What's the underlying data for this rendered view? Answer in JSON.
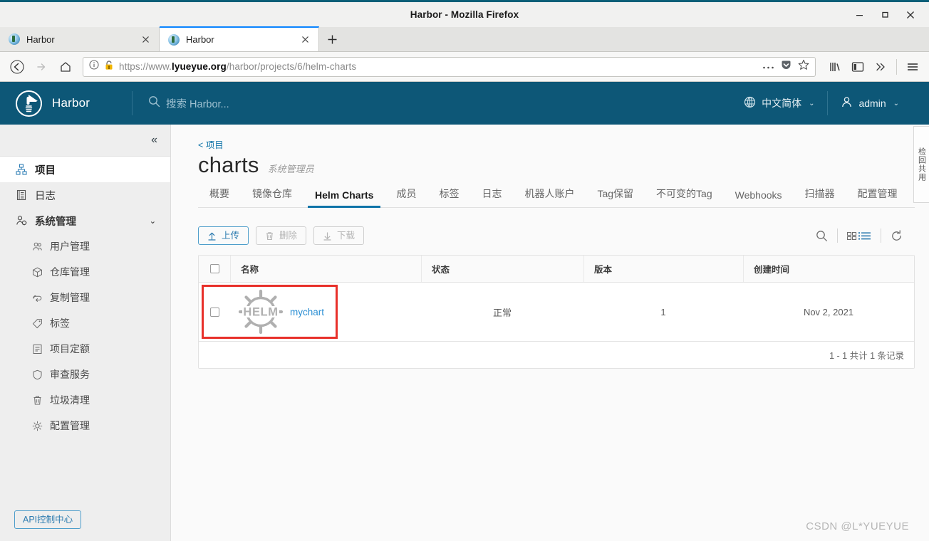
{
  "window": {
    "title": "Harbor - Mozilla Firefox",
    "minimize_label": "minimize",
    "maximize_label": "maximize",
    "close_label": "close"
  },
  "browser": {
    "tabs": [
      {
        "title": "Harbor",
        "active": false
      },
      {
        "title": "Harbor",
        "active": true
      }
    ],
    "new_tab_label": "+",
    "url_full": "https://www.lyueyue.org/harbor/projects/6/helm-charts",
    "url_scheme": "https://www.",
    "url_host_bold": "lyueyue.org",
    "url_path": "/harbor/projects/6/helm-charts",
    "icons": {
      "back": "back-arrow-icon",
      "forward": "forward-arrow-icon",
      "home": "home-icon",
      "info": "info-circle-icon",
      "insecure": "insecure-lock-icon",
      "page_actions": "ellipsis-icon",
      "pocket": "pocket-icon",
      "bookmark": "star-icon",
      "library": "library-icon",
      "sidebar": "sidebar-icon",
      "overflow": "chevron-double-right-icon",
      "menu": "hamburger-menu-icon"
    }
  },
  "header": {
    "brand": "Harbor",
    "search_placeholder": "搜索 Harbor...",
    "language": "中文简体",
    "user": "admin"
  },
  "sidebar": {
    "collapse_label": "«",
    "items": [
      {
        "label": "项目",
        "icon": "project-icon",
        "selected": true
      },
      {
        "label": "日志",
        "icon": "log-icon",
        "selected": false
      },
      {
        "label": "系统管理",
        "icon": "administration-icon",
        "selected": false,
        "expandable": true
      }
    ],
    "sub_items": [
      {
        "label": "用户管理",
        "icon": "users-icon"
      },
      {
        "label": "仓库管理",
        "icon": "registry-icon"
      },
      {
        "label": "复制管理",
        "icon": "replication-icon"
      },
      {
        "label": "标签",
        "icon": "label-tag-icon"
      },
      {
        "label": "项目定额",
        "icon": "quota-icon"
      },
      {
        "label": "审查服务",
        "icon": "shield-icon"
      },
      {
        "label": "垃圾清理",
        "icon": "trash-icon"
      },
      {
        "label": "配置管理",
        "icon": "gear-icon"
      }
    ],
    "api_button": "API控制中心"
  },
  "main": {
    "breadcrumb": "< 项目",
    "title": "charts",
    "role": "系统管理员",
    "tabs": [
      {
        "label": "概要",
        "active": false
      },
      {
        "label": "镜像仓库",
        "active": false
      },
      {
        "label": "Helm Charts",
        "active": true
      },
      {
        "label": "成员",
        "active": false
      },
      {
        "label": "标签",
        "active": false
      },
      {
        "label": "日志",
        "active": false
      },
      {
        "label": "机器人账户",
        "active": false
      },
      {
        "label": "Tag保留",
        "active": false
      },
      {
        "label": "不可变的Tag",
        "active": false
      },
      {
        "label": "Webhooks",
        "active": false
      },
      {
        "label": "扫描器",
        "active": false
      },
      {
        "label": "配置管理",
        "active": false
      }
    ],
    "toolbar": {
      "upload_label": "上传",
      "delete_label": "删除",
      "download_label": "下载",
      "upload_icon": "upload-arrow-icon",
      "delete_icon": "trash-icon",
      "download_icon": "download-arrow-icon",
      "search_icon": "search-icon",
      "view_grid_icon": "grid-view-icon",
      "view_list_icon": "list-view-icon",
      "refresh_icon": "refresh-icon"
    },
    "table": {
      "columns": [
        "名称",
        "状态",
        "版本",
        "创建时间"
      ],
      "rows": [
        {
          "name": "mychart",
          "logo": "helm-logo",
          "status": "正常",
          "version": "1",
          "created": "Nov 2, 2021",
          "highlighted": true
        }
      ],
      "footer": "1 - 1 共计 1 条记录"
    }
  },
  "side_tab": {
    "label": "检回共用"
  },
  "watermark": "CSDN @L*YUEYUE",
  "colors": {
    "harbor_blue": "#0d5777",
    "accent": "#0f74a8",
    "link": "#2b8fd4",
    "highlight_box": "#e8302a",
    "firefox_top": "#0a5f78"
  }
}
